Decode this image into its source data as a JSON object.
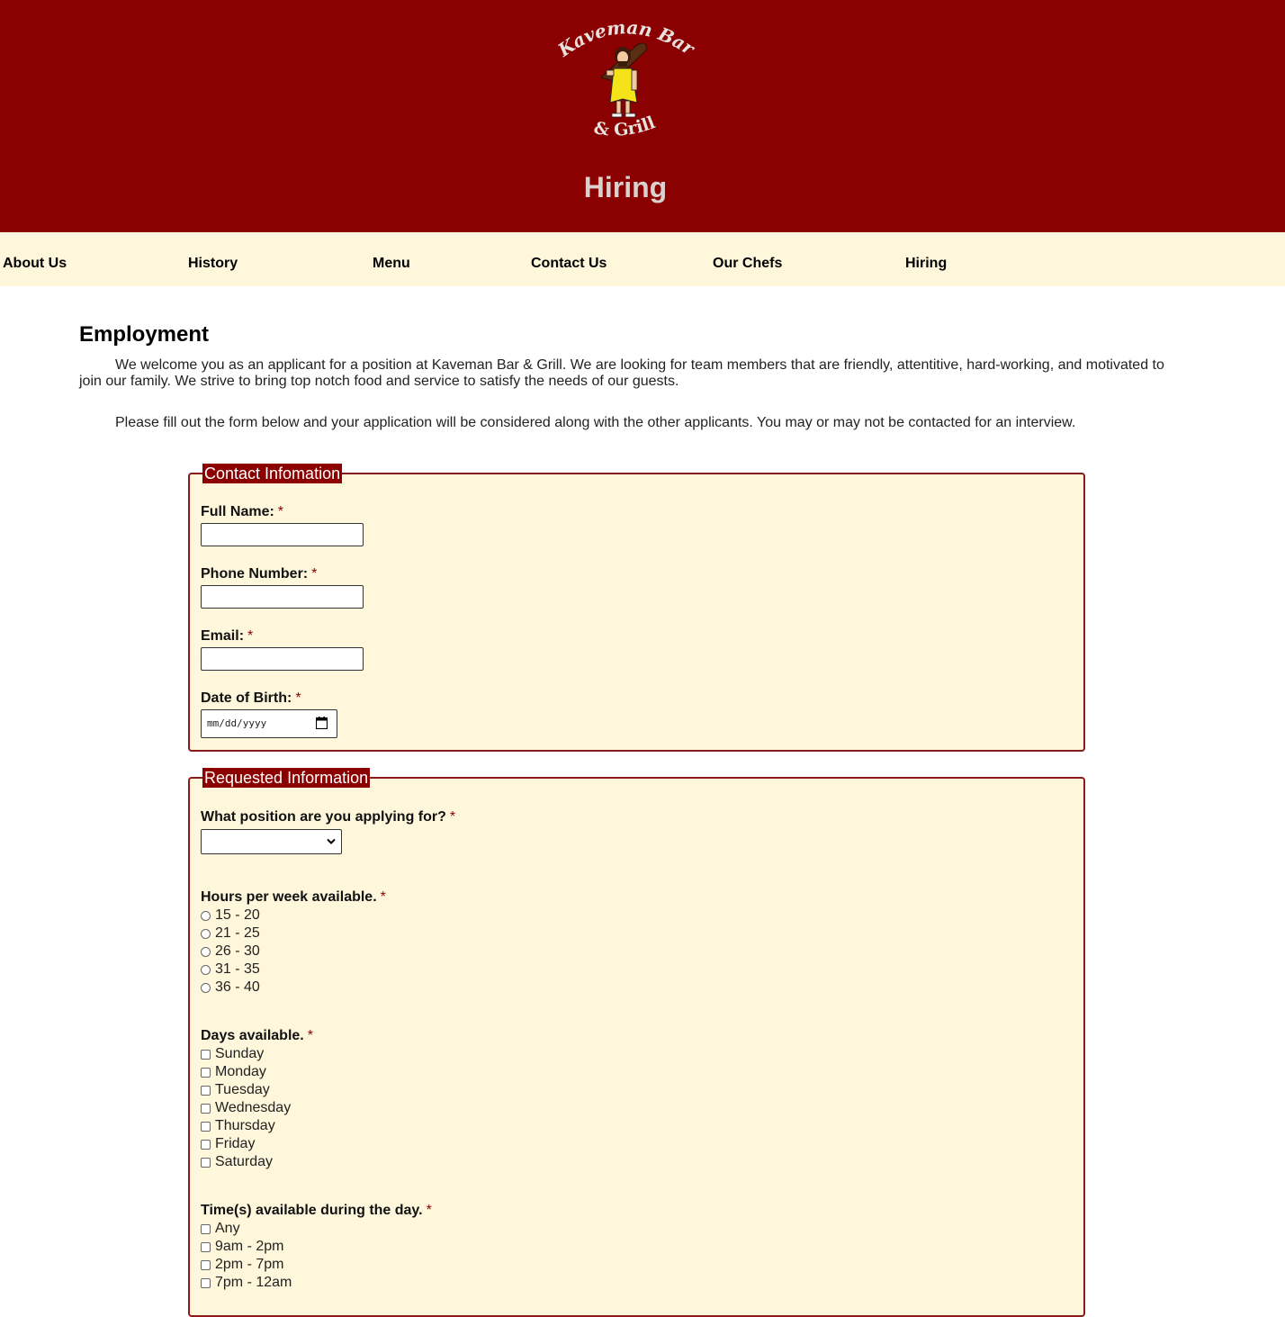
{
  "header": {
    "logo": {
      "top_text": "Kaveman Bar",
      "bottom_text": "& Grill"
    },
    "page_heading": "Hiring"
  },
  "nav": [
    "About Us",
    "History",
    "Menu",
    "Contact Us",
    "Our Chefs",
    "Hiring"
  ],
  "main": {
    "title": "Employment",
    "intro_1": "We welcome you as an applicant for a position at Kaveman Bar & Grill. We are looking for team members that are friendly, attentitive, hard-working, and motivated to join our family. We strive to bring top notch food and service to satisfy the needs of our guests.",
    "intro_2": "Please fill out the form below and your application will be considered along with the other applicants. You may or may not be contacted for an interview."
  },
  "contact": {
    "legend": "Contact Infomation",
    "full_name_label": "Full Name:",
    "full_name_value": "",
    "phone_label": "Phone Number:",
    "phone_value": "",
    "email_label": "Email:",
    "email_value": "",
    "dob_label": "Date of Birth:",
    "dob_placeholder": "mm/dd/yyyy",
    "required_mark": "*"
  },
  "requested": {
    "legend": "Requested Information",
    "position_label": "What position are you applying for?",
    "position_value": "",
    "hours_label": "Hours per week available.",
    "hours_options": [
      "15 - 20",
      "21 - 25",
      "26 - 30",
      "31 - 35",
      "36 - 40"
    ],
    "days_label": "Days available.",
    "days_options": [
      "Sunday",
      "Monday",
      "Tuesday",
      "Wednesday",
      "Thursday",
      "Friday",
      "Saturday"
    ],
    "times_label": "Time(s) available during the day.",
    "times_options": [
      "Any",
      "9am - 2pm",
      "2pm - 7pm",
      "7pm - 12am"
    ]
  },
  "colors": {
    "header_bg": "#8b0000",
    "nav_bg": "#fff7db",
    "fieldset_bg": "#fff7db",
    "fieldset_border": "#8b1a1a",
    "required": "#8b0000"
  }
}
